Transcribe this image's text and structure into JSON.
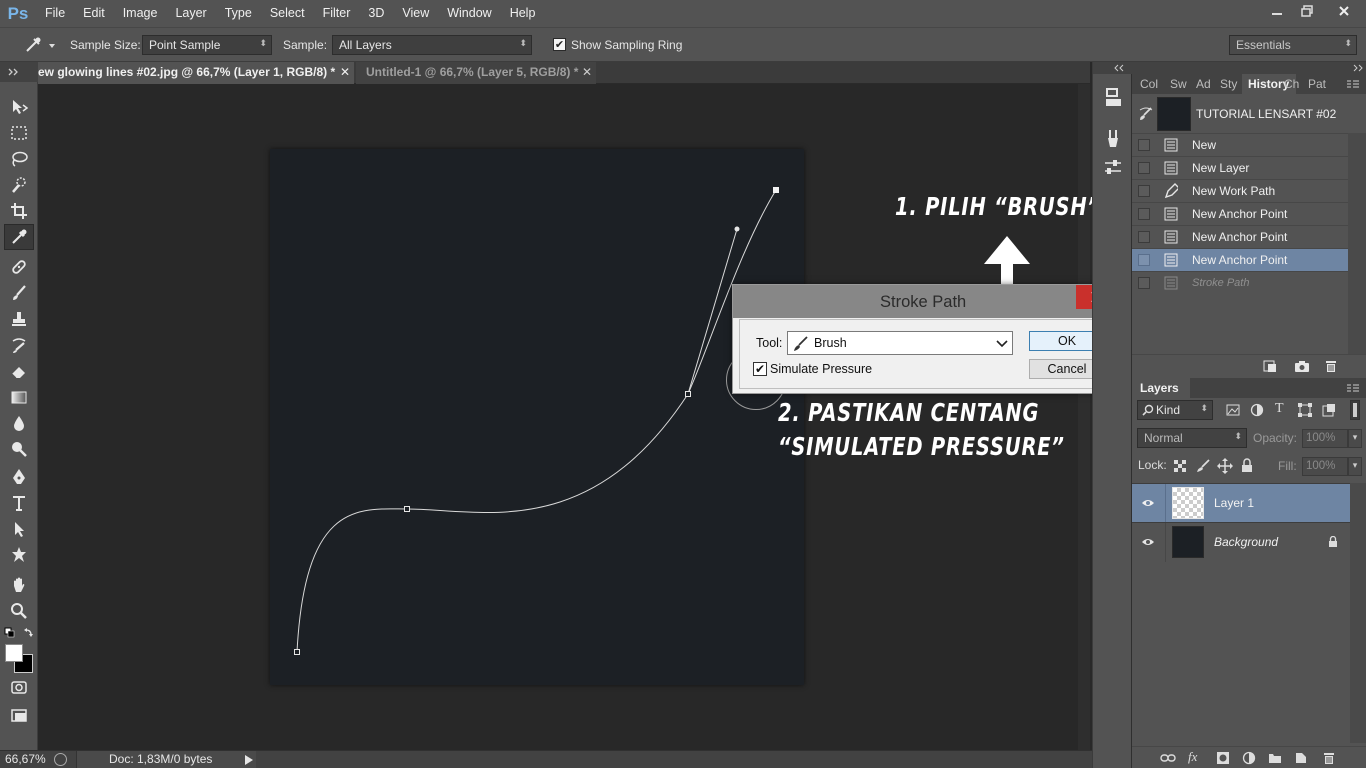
{
  "app": {
    "logo": "Ps",
    "menu": [
      "File",
      "Edit",
      "Image",
      "Layer",
      "Type",
      "Select",
      "Filter",
      "3D",
      "View",
      "Window",
      "Help"
    ]
  },
  "options": {
    "sample_size_label": "Sample Size:",
    "sample_size_value": "Point Sample",
    "sample_label": "Sample:",
    "sample_value": "All Layers",
    "show_sampling_ring": "Show Sampling Ring",
    "workspace": "Essentials"
  },
  "tabs": [
    {
      "label": "ew glowing lines #02.jpg @ 66,7% (Layer 1, RGB/8) *",
      "active": true
    },
    {
      "label": "Untitled-1 @ 66,7% (Layer 5, RGB/8) *",
      "active": false
    }
  ],
  "status": {
    "zoom": "66,67%",
    "doc": "Doc: 1,83M/0 bytes"
  },
  "panel_tabs": [
    "Col",
    "Sw",
    "Ad",
    "Sty",
    "History",
    "Ch",
    "Pat"
  ],
  "history": {
    "snapshot": "TUTORIAL LENSART #02",
    "items": [
      {
        "label": "New",
        "icon": "document-icon"
      },
      {
        "label": "New Layer",
        "icon": "document-icon"
      },
      {
        "label": "New Work Path",
        "icon": "pen-icon"
      },
      {
        "label": "New Anchor Point",
        "icon": "document-icon"
      },
      {
        "label": "New Anchor Point",
        "icon": "document-icon"
      },
      {
        "label": "New Anchor Point",
        "icon": "document-icon",
        "selected": true
      },
      {
        "label": "Stroke Path",
        "icon": "document-icon",
        "dimmed": true
      }
    ]
  },
  "layers": {
    "tab": "Layers",
    "filter": "Kind",
    "blend": "Normal",
    "opacity_label": "Opacity:",
    "opacity": "100%",
    "lock_label": "Lock:",
    "fill_label": "Fill:",
    "fill": "100%",
    "items": [
      {
        "name": "Layer 1",
        "selected": true
      },
      {
        "name": "Background",
        "locked": true
      }
    ]
  },
  "dialog": {
    "title": "Stroke Path",
    "tool_label": "Tool:",
    "tool_value": "Brush",
    "simulate_pressure": "Simulate Pressure",
    "ok": "OK",
    "cancel": "Cancel"
  },
  "annotations": {
    "step1": "1. PILIH “BRUSH”",
    "step2_line1": "2. PASTIKAN CENTANG",
    "step2_line2": "“SIMULATED PRESSURE”"
  },
  "colors": {
    "ui_dark": "#535353",
    "document_bg": "#1c2025",
    "selection": "#6e85a3",
    "close_red": "#c9302c"
  }
}
